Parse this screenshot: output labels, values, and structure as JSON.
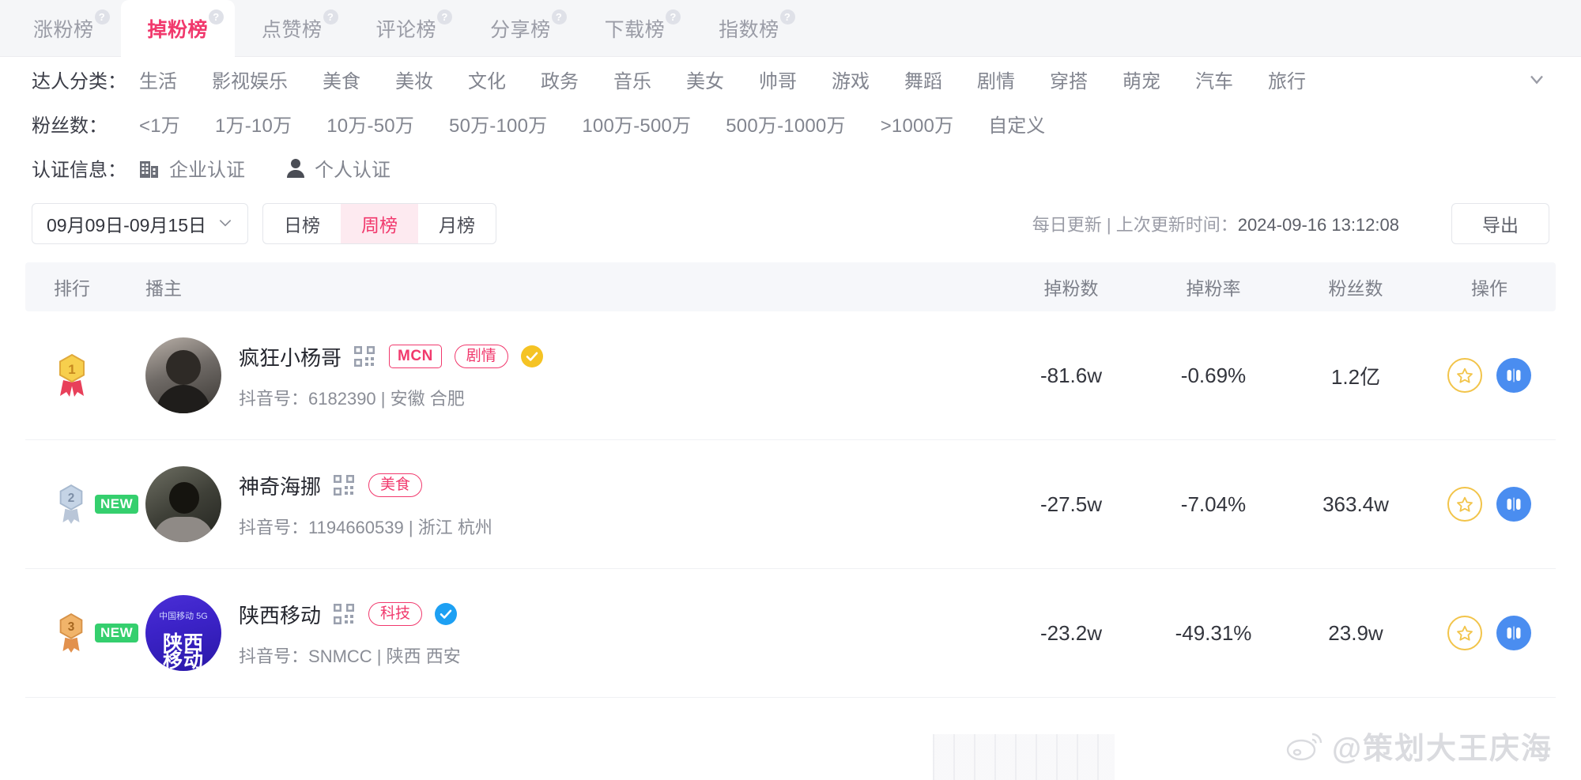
{
  "tabs": [
    {
      "label": "涨粉榜",
      "active": false,
      "help": "?"
    },
    {
      "label": "掉粉榜",
      "active": true,
      "help": "?"
    },
    {
      "label": "点赞榜",
      "active": false,
      "help": "?"
    },
    {
      "label": "评论榜",
      "active": false,
      "help": "?"
    },
    {
      "label": "分享榜",
      "active": false,
      "help": "?"
    },
    {
      "label": "下载榜",
      "active": false,
      "help": "?"
    },
    {
      "label": "指数榜",
      "active": false,
      "help": "?"
    }
  ],
  "filters": {
    "category": {
      "label": "达人分类：",
      "options": [
        "生活",
        "影视娱乐",
        "美食",
        "美妆",
        "文化",
        "政务",
        "音乐",
        "美女",
        "帅哥",
        "游戏",
        "舞蹈",
        "剧情",
        "穿搭",
        "萌宠",
        "汽车",
        "旅行"
      ]
    },
    "fans": {
      "label": "粉丝数：",
      "options": [
        "<1万",
        "1万-10万",
        "10万-50万",
        "50万-100万",
        "100万-500万",
        "500万-1000万",
        ">1000万",
        "自定义"
      ]
    },
    "cert": {
      "label": "认证信息：",
      "options": [
        {
          "label": "企业认证",
          "icon": "building-icon"
        },
        {
          "label": "个人认证",
          "icon": "person-icon"
        }
      ]
    }
  },
  "controls": {
    "date_range": "09月09日-09月15日",
    "period_options": [
      {
        "label": "日榜",
        "active": false
      },
      {
        "label": "周榜",
        "active": true
      },
      {
        "label": "月榜",
        "active": false
      }
    ],
    "update_prefix": "每日更新 | 上次更新时间：",
    "update_time": "2024-09-16 13:12:08",
    "export_label": "导出"
  },
  "table": {
    "headers": {
      "rank": "排行",
      "host": "播主",
      "drop_count": "掉粉数",
      "drop_rate": "掉粉率",
      "fans": "粉丝数",
      "action": "操作"
    },
    "rows": [
      {
        "rank": "1",
        "medal": "gold-medal",
        "new": "",
        "name": "疯狂小杨哥",
        "qr": "qr-code-icon",
        "tags": [
          "MCN",
          "剧情"
        ],
        "verified": "yellow",
        "account_label": "抖音号：",
        "account_id": "6182390",
        "location": "安徽 合肥",
        "drop_count": "-81.6w",
        "drop_rate": "-0.69%",
        "fans": "1.2亿"
      },
      {
        "rank": "2",
        "medal": "silver-medal",
        "new": "NEW",
        "name": "神奇海挪",
        "qr": "qr-code-icon",
        "tags": [
          "美食"
        ],
        "verified": "",
        "account_label": "抖音号：",
        "account_id": "1194660539",
        "location": "浙江 杭州",
        "drop_count": "-27.5w",
        "drop_rate": "-7.04%",
        "fans": "363.4w"
      },
      {
        "rank": "3",
        "medal": "bronze-medal",
        "new": "NEW",
        "name": "陕西移动",
        "qr": "qr-code-icon",
        "tags": [
          "科技"
        ],
        "verified": "blue",
        "account_label": "抖音号：",
        "account_id": "SNMCC",
        "location": "陕西 西安",
        "drop_count": "-23.2w",
        "drop_rate": "-49.31%",
        "fans": "23.9w"
      }
    ]
  },
  "watermark": {
    "text": "@策划大王庆海",
    "icon": "weibo-icon"
  },
  "colors": {
    "accent": "#f1396d",
    "accent_soft": "#fdeaf0",
    "new_green": "#35cf6e",
    "blue": "#1da0f3",
    "gold": "#f5c324"
  }
}
